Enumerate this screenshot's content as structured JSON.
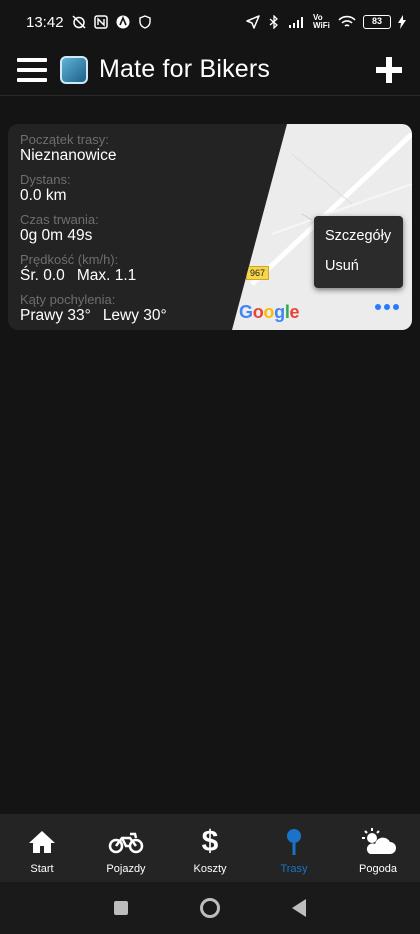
{
  "status_bar": {
    "time": "13:42",
    "network_label": "Vo WiFi",
    "battery": "83",
    "left_icons": [
      "alarm-off-icon",
      "nfc-icon",
      "app-icon",
      "shield-icon"
    ],
    "right_icons": [
      "location-icon",
      "bluetooth-icon",
      "signal-icon",
      "wifi-icon",
      "charging-icon"
    ]
  },
  "app_bar": {
    "title": "Mate for Bikers"
  },
  "route": {
    "start_label": "Początek trasy:",
    "start_value": "Nieznanowice",
    "distance_label": "Dystans:",
    "distance_value": "0.0 km",
    "duration_label": "Czas trwania:",
    "duration_value": "0g 0m 49s",
    "speed_label": "Prędkość (km/h):",
    "speed_avg": "Śr. 0.0",
    "speed_max": "Max. 1.1",
    "angles_label": "Kąty pochylenia:",
    "angle_right": "Prawy 33°",
    "angle_left": "Lewy 30°",
    "map": {
      "road_number": "967",
      "logo_text": [
        "G",
        "o",
        "o",
        "g",
        "l",
        "e"
      ]
    }
  },
  "popup_menu": {
    "items": [
      "Szczegóły",
      "Usuń"
    ]
  },
  "bottom_nav": {
    "items": [
      {
        "label": "Start",
        "icon": "home-icon"
      },
      {
        "label": "Pojazdy",
        "icon": "motorcycle-icon"
      },
      {
        "label": "Koszty",
        "icon": "dollar-icon"
      },
      {
        "label": "Trasy",
        "icon": "map-pin-icon"
      },
      {
        "label": "Pogoda",
        "icon": "weather-icon"
      }
    ],
    "active_index": 3
  },
  "colors": {
    "accent": "#1a73c9",
    "background": "#141414",
    "card": "#232323",
    "muted_text": "#6e6e6e"
  }
}
